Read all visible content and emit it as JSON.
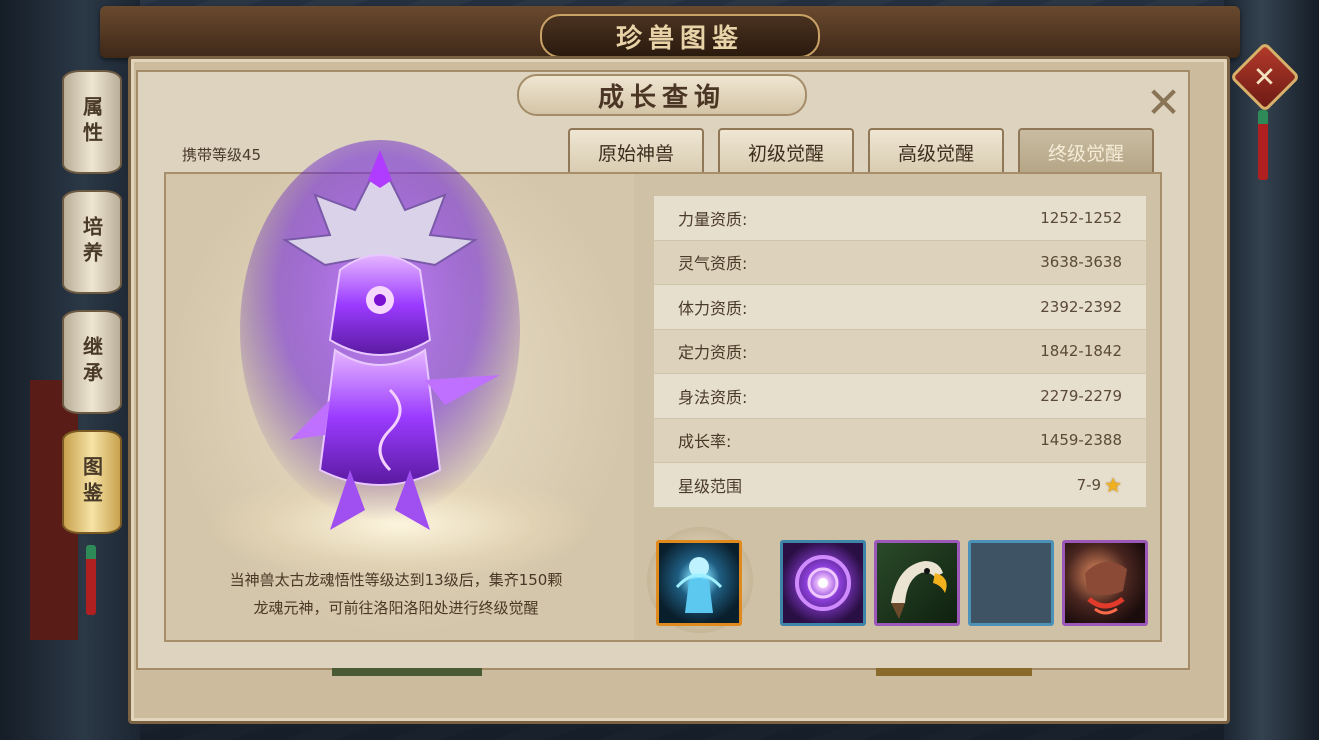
{
  "window": {
    "title": "珍兽图鉴"
  },
  "panel": {
    "title": "成长查询",
    "close_label": "✕"
  },
  "side_nav": [
    {
      "label": "属性",
      "active": false
    },
    {
      "label": "培养",
      "active": false
    },
    {
      "label": "继承",
      "active": false
    },
    {
      "label": "图鉴",
      "active": true
    }
  ],
  "carry_level": {
    "label": "携带等级45"
  },
  "tabs": [
    {
      "label": "原始神兽",
      "active": false
    },
    {
      "label": "初级觉醒",
      "active": false
    },
    {
      "label": "高级觉醒",
      "active": false
    },
    {
      "label": "终级觉醒",
      "active": true
    }
  ],
  "stats": [
    {
      "name": "力量资质:",
      "value": "1252-1252"
    },
    {
      "name": "灵气资质:",
      "value": "3638-3638"
    },
    {
      "name": "体力资质:",
      "value": "2392-2392"
    },
    {
      "name": "定力资质:",
      "value": "1842-1842"
    },
    {
      "name": "身法资质:",
      "value": "2279-2279"
    },
    {
      "name": "成长率:",
      "value": "1459-2388"
    },
    {
      "name": "星级范围",
      "value": "7-9"
    }
  ],
  "description": {
    "line1": "当神兽太古龙魂悟性等级达到13级后，集齐150颗",
    "line2": "龙魂元神，可前往洛阳洛阳处进行终级觉醒"
  },
  "skills": [
    {
      "icon": "spirit-figure-icon",
      "rarity": "orange"
    },
    {
      "icon": "vortex-icon",
      "rarity": "blue"
    },
    {
      "icon": "eagle-icon",
      "rarity": "purple"
    },
    {
      "icon": "empty-slot",
      "rarity": "blue"
    },
    {
      "icon": "flame-fist-icon",
      "rarity": "purple"
    }
  ],
  "colors": {
    "panel_bg": "#ddd3bf",
    "accent_gold": "#c9a266",
    "creature_purple": "#9a3bff",
    "star": "#f0b020"
  }
}
